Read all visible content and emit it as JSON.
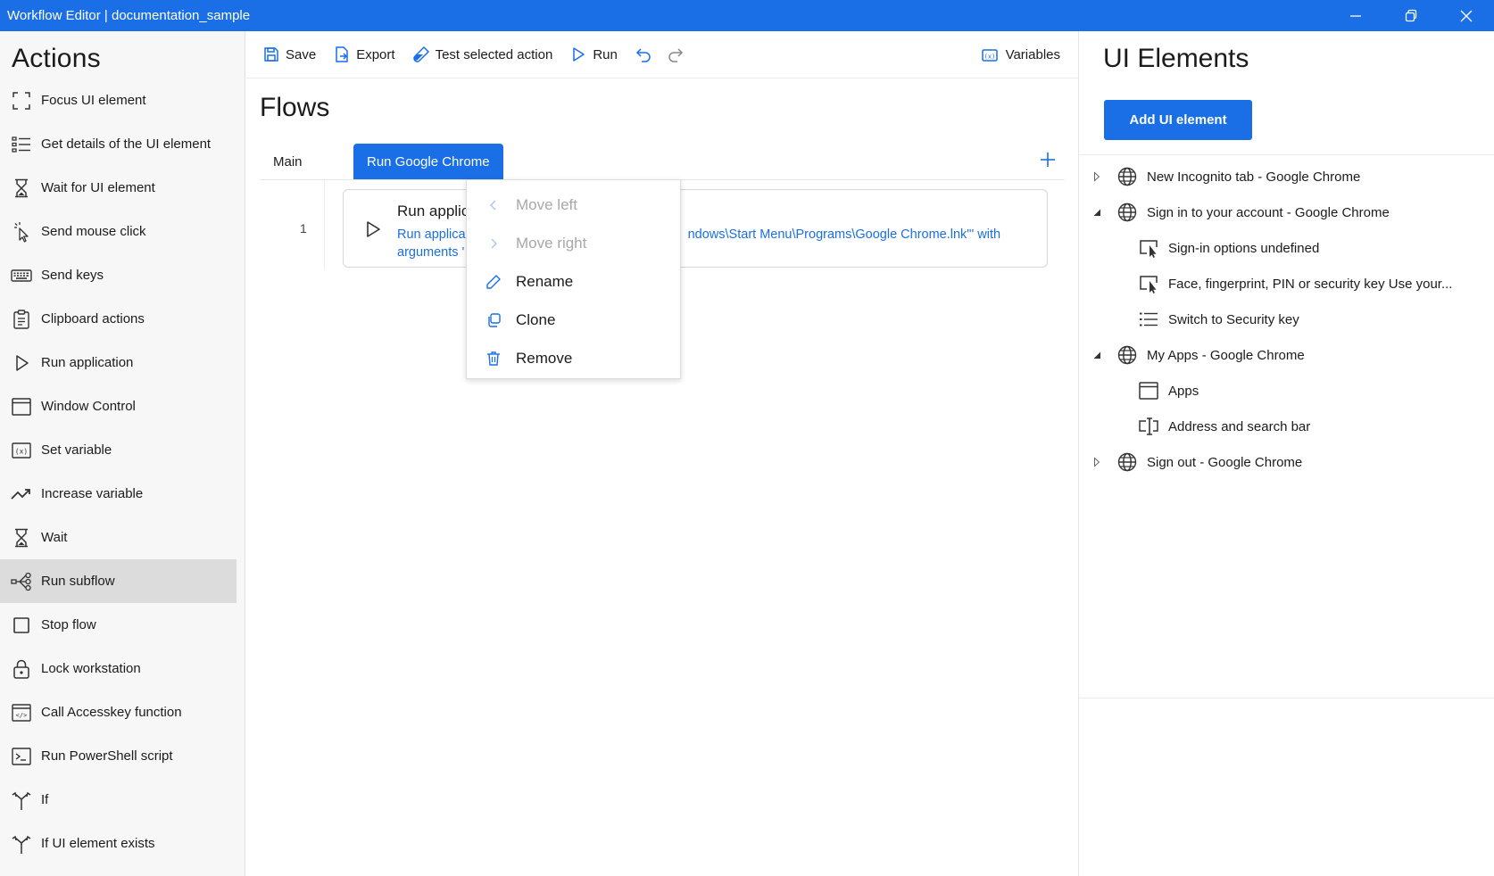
{
  "window": {
    "title": "Workflow Editor | documentation_sample",
    "minimize_icon": "minimize-icon",
    "restore_icon": "restore-icon",
    "close_icon": "close-icon"
  },
  "actions_panel": {
    "title": "Actions",
    "items": [
      {
        "label": "Focus UI element",
        "icon": "focus-icon"
      },
      {
        "label": "Get details of the UI element",
        "icon": "details-list-icon"
      },
      {
        "label": "Wait for UI element",
        "icon": "hourglass-icon"
      },
      {
        "label": "Send mouse click",
        "icon": "mouse-click-icon"
      },
      {
        "label": "Send keys",
        "icon": "keyboard-icon"
      },
      {
        "label": "Clipboard actions",
        "icon": "clipboard-icon"
      },
      {
        "label": "Run application",
        "icon": "play-icon"
      },
      {
        "label": "Window Control",
        "icon": "window-icon"
      },
      {
        "label": "Set variable",
        "icon": "variable-icon"
      },
      {
        "label": "Increase variable",
        "icon": "trend-up-icon"
      },
      {
        "label": "Wait",
        "icon": "hourglass-icon"
      },
      {
        "label": "Run subflow",
        "icon": "subflow-icon",
        "selected": true
      },
      {
        "label": "Stop flow",
        "icon": "stop-icon"
      },
      {
        "label": "Lock workstation",
        "icon": "lock-icon"
      },
      {
        "label": "Call Accesskey function",
        "icon": "code-window-icon"
      },
      {
        "label": "Run PowerShell script",
        "icon": "terminal-icon"
      },
      {
        "label": "If",
        "icon": "branch-icon"
      },
      {
        "label": "If UI element exists",
        "icon": "branch-icon"
      }
    ]
  },
  "toolbar": {
    "save_label": "Save",
    "export_label": "Export",
    "test_label": "Test selected action",
    "run_label": "Run",
    "variables_label": "Variables"
  },
  "flows": {
    "title": "Flows",
    "tabs": [
      {
        "label": "Main",
        "active": false
      },
      {
        "label": "Run Google Chrome",
        "active": true
      }
    ],
    "rows": [
      {
        "line": "1",
        "title": "Run applic",
        "desc_line1": "Run applicat",
        "desc_line1_end": "ndows\\Start Menu\\Programs\\Google Chrome.lnk\"' with",
        "desc_line2": "arguments '"
      }
    ]
  },
  "context_menu": {
    "items": [
      {
        "label": "Move left",
        "icon": "chevron-left-icon",
        "disabled": true
      },
      {
        "label": "Move right",
        "icon": "chevron-right-icon",
        "disabled": true
      },
      {
        "label": "Rename",
        "icon": "pencil-icon",
        "disabled": false
      },
      {
        "label": "Clone",
        "icon": "clone-icon",
        "disabled": false
      },
      {
        "label": "Remove",
        "icon": "trash-icon",
        "disabled": false
      }
    ]
  },
  "ui_elements": {
    "title": "UI Elements",
    "add_button": "Add UI element",
    "tree": [
      {
        "label": "New Incognito tab - Google Chrome",
        "level": 0,
        "caret": "collapsed",
        "icon": "globe-icon"
      },
      {
        "label": "Sign in to your account - Google Chrome",
        "level": 0,
        "caret": "expanded",
        "icon": "globe-icon"
      },
      {
        "label": "Sign-in options undefined",
        "level": 1,
        "caret": "none",
        "icon": "screen-click-icon"
      },
      {
        "label": "Face, fingerprint, PIN or security key Use your...",
        "level": 1,
        "caret": "none",
        "icon": "screen-click-icon"
      },
      {
        "label": "Switch to Security key",
        "level": 1,
        "caret": "none",
        "icon": "list-icon"
      },
      {
        "label": "My Apps - Google Chrome",
        "level": 0,
        "caret": "expanded",
        "icon": "globe-icon"
      },
      {
        "label": "Apps",
        "level": 1,
        "caret": "none",
        "icon": "window-icon"
      },
      {
        "label": "Address and search bar",
        "level": 1,
        "caret": "none",
        "icon": "textbox-icon"
      },
      {
        "label": "Sign out - Google Chrome",
        "level": 0,
        "caret": "collapsed",
        "icon": "globe-icon"
      }
    ]
  },
  "colors": {
    "accent": "#1a6fe6",
    "selected_bg": "#dcdcdc",
    "disabled_text": "#a8a8a8"
  }
}
